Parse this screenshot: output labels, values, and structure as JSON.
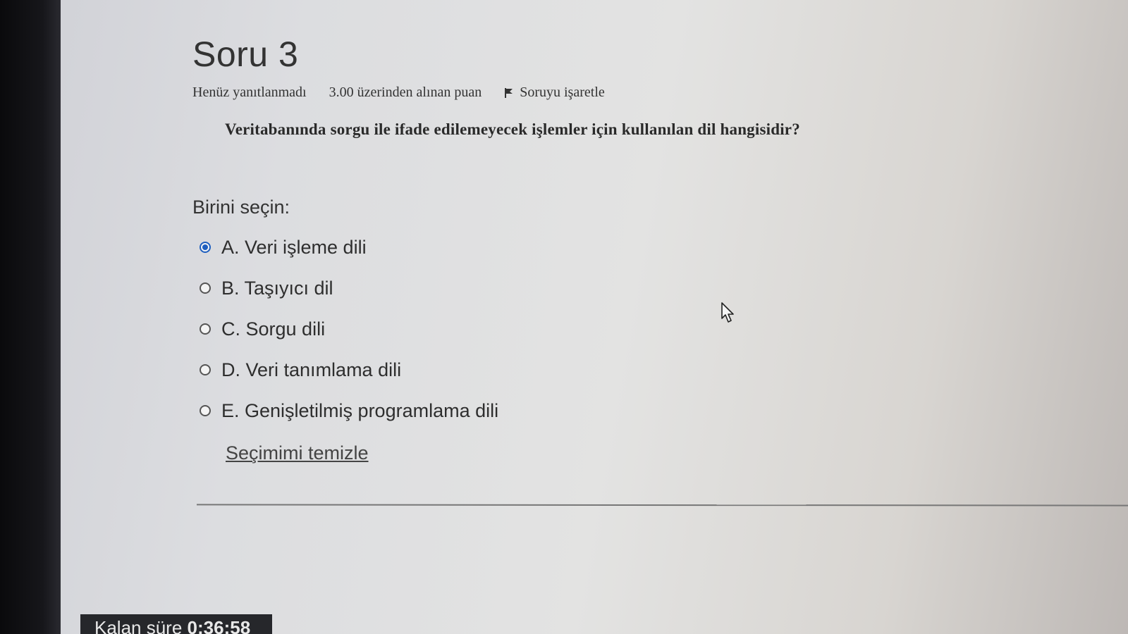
{
  "question": {
    "title": "Soru 3",
    "status": "Henüz yanıtlanmadı",
    "grade": "3.00 üzerinden alınan puan",
    "flag_label": "Soruyu işaretle",
    "text": "Veritabanında sorgu ile ifade edilemeyecek işlemler için kullanılan dil hangisidir?"
  },
  "prompt": "Birini seçin:",
  "answers": [
    {
      "label": "A. Veri işleme dili",
      "selected": true
    },
    {
      "label": "B. Taşıyıcı dil",
      "selected": false
    },
    {
      "label": "C. Sorgu dili",
      "selected": false
    },
    {
      "label": "D. Veri tanımlama dili",
      "selected": false
    },
    {
      "label": "E. Genişletilmiş programlama dili",
      "selected": false
    }
  ],
  "clear_label": "Seçimimi temizle",
  "timer": {
    "label": "Kalan süre",
    "value": "0:36:58"
  },
  "colors": {
    "radio_selected": "#1f5fbf",
    "text": "#333333",
    "timer_bg": "#26272b"
  },
  "icons": {
    "flag": "flag-icon",
    "cursor": "mouse-cursor-icon"
  }
}
